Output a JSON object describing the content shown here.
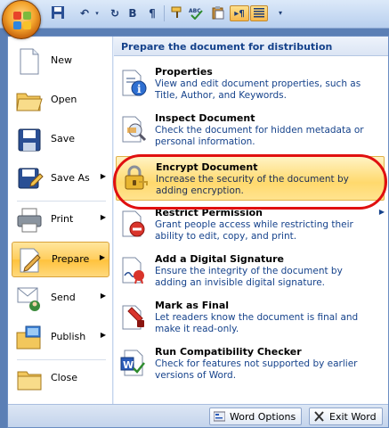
{
  "qat": {
    "icons": [
      "office-button",
      "save-icon",
      "undo-icon",
      "redo-icon",
      "bold-icon",
      "pilcrow-icon",
      "format-painter-icon",
      "spelling-icon",
      "paste-icon",
      "paragraph-marks-icon",
      "align-icon",
      "dropdown-icon"
    ],
    "bold_glyph": "B",
    "pilcrow_glyph": "¶"
  },
  "left_menu": {
    "items": [
      {
        "label": "New",
        "underline": "N"
      },
      {
        "label": "Open",
        "underline": "O"
      },
      {
        "label": "Save",
        "underline": "S"
      },
      {
        "label": "Save As",
        "underline": "A",
        "has_submenu": true
      },
      {
        "label": "Print",
        "underline": "P",
        "has_submenu": true
      },
      {
        "label": "Prepare",
        "underline": "E",
        "has_submenu": true,
        "active": true
      },
      {
        "label": "Send",
        "underline": "D",
        "has_submenu": true
      },
      {
        "label": "Publish",
        "underline": "U",
        "has_submenu": true
      },
      {
        "label": "Close",
        "underline": "C"
      }
    ]
  },
  "right_menu": {
    "title": "Prepare the document for distribution",
    "items": [
      {
        "title": "Properties",
        "desc": "View and edit document properties, such as Title, Author, and Keywords."
      },
      {
        "title": "Inspect Document",
        "desc": "Check the document for hidden metadata or personal information."
      },
      {
        "title": "Encrypt Document",
        "desc": "Increase the security of the document by adding encryption.",
        "highlighted": true
      },
      {
        "title": "Restrict Permission",
        "desc": "Grant people access while restricting their ability to edit, copy, and print.",
        "has_submenu": true
      },
      {
        "title": "Add a Digital Signature",
        "desc": "Ensure the integrity of the document by adding an invisible digital signature."
      },
      {
        "title": "Mark as Final",
        "desc": "Let readers know the document is final and make it read-only."
      },
      {
        "title": "Run Compatibility Checker",
        "desc": "Check for features not supported by earlier versions of Word."
      }
    ]
  },
  "footer": {
    "word_options": "Word Options",
    "exit_word": "Exit Word"
  },
  "colors": {
    "menu_text": "#15428b",
    "highlight": "#ffd96d",
    "annotation_ring": "#e01010"
  }
}
